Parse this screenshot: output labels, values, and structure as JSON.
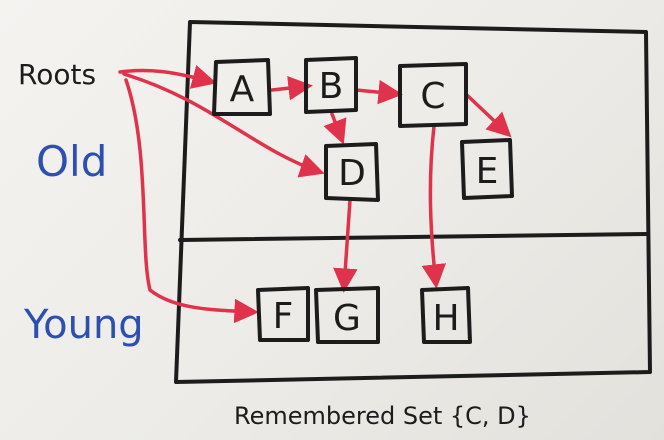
{
  "labels": {
    "roots": "Roots",
    "old": "Old",
    "young": "Young",
    "remembered_set": "Remembered Set {C, D}"
  },
  "nodes": [
    {
      "id": "A",
      "label": "A",
      "generation": "Old"
    },
    {
      "id": "B",
      "label": "B",
      "generation": "Old"
    },
    {
      "id": "C",
      "label": "C",
      "generation": "Old"
    },
    {
      "id": "D",
      "label": "D",
      "generation": "Old"
    },
    {
      "id": "E",
      "label": "E",
      "generation": "Old"
    },
    {
      "id": "F",
      "label": "F",
      "generation": "Young"
    },
    {
      "id": "G",
      "label": "G",
      "generation": "Young"
    },
    {
      "id": "H",
      "label": "H",
      "generation": "Young"
    }
  ],
  "edges": [
    {
      "from": "Roots",
      "to": "A"
    },
    {
      "from": "Roots",
      "to": "D"
    },
    {
      "from": "Roots",
      "to": "F"
    },
    {
      "from": "A",
      "to": "B"
    },
    {
      "from": "B",
      "to": "C"
    },
    {
      "from": "B",
      "to": "D"
    },
    {
      "from": "C",
      "to": "E"
    },
    {
      "from": "C",
      "to": "H"
    },
    {
      "from": "D",
      "to": "G"
    }
  ],
  "colors": {
    "ink": "#1c1c1c",
    "arrow": "#e0324a",
    "label_blue": "#2d4fb0"
  }
}
